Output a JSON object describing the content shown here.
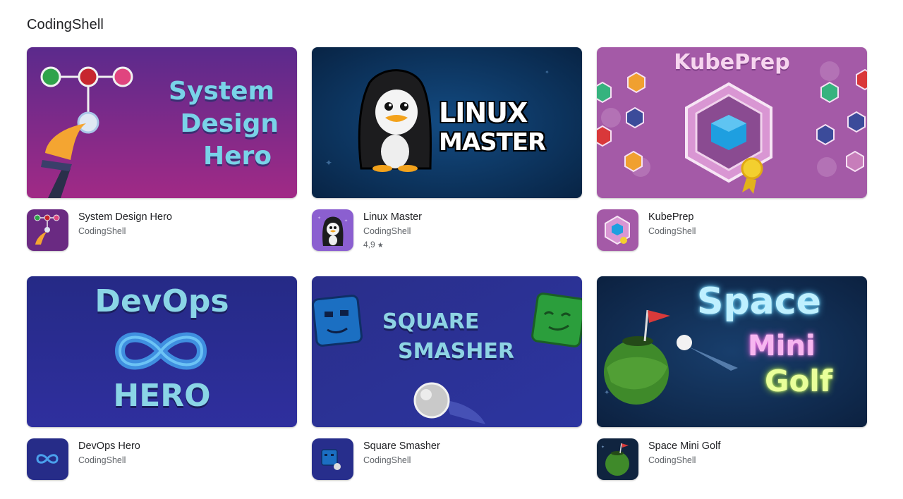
{
  "developer": {
    "title": "CodingShell"
  },
  "apps": [
    {
      "name": "System Design Hero",
      "developer": "CodingShell",
      "rating": "",
      "banner_text": [
        "System",
        "Design",
        "Hero"
      ]
    },
    {
      "name": "Linux Master",
      "developer": "CodingShell",
      "rating": "4,9",
      "banner_text": [
        "LINUX",
        "MASTER"
      ]
    },
    {
      "name": "KubePrep",
      "developer": "CodingShell",
      "rating": "",
      "banner_text": [
        "KubePrep"
      ]
    },
    {
      "name": "DevOps Hero",
      "developer": "CodingShell",
      "rating": "",
      "banner_text": [
        "DevOps",
        "HERO"
      ]
    },
    {
      "name": "Square Smasher",
      "developer": "CodingShell",
      "rating": "",
      "banner_text": [
        "SQUARE",
        "SMASHER"
      ]
    },
    {
      "name": "Space Mini Golf",
      "developer": "CodingShell",
      "rating": "",
      "banner_text": [
        "Space",
        "Mini",
        "Golf"
      ]
    }
  ],
  "rating_star": "★",
  "colors": {
    "system_design_bg": "#7a2a85",
    "linux_bg": "#0d3a66",
    "kubeprep_bg": "#a45aa7",
    "devops_bg": "#272f8f",
    "square_bg": "#2b318f",
    "golf_bg": "#0f2a4f"
  }
}
